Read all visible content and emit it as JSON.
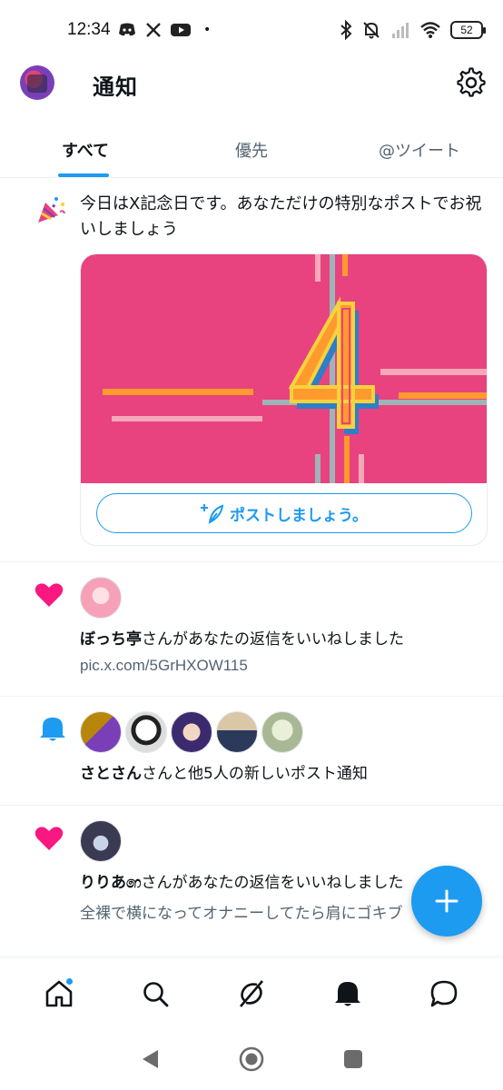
{
  "status_bar": {
    "time": "12:34",
    "battery": "52",
    "dot": "•"
  },
  "header": {
    "title": "通知"
  },
  "tabs": [
    {
      "label": "すべて"
    },
    {
      "label": "優先"
    },
    {
      "label": "@ツイート"
    }
  ],
  "items": {
    "anniversary": {
      "text": "今日はX記念日です。あなただけの特別なポストでお祝いしましょう",
      "button_label": "ポストしましょう。"
    },
    "like1": {
      "user": "ぼっち亭",
      "action": "さんがあなたの返信をいいねしました",
      "link": "pic.x.com/5GrHXOW115"
    },
    "notify": {
      "user": "さとさん",
      "action": "さんと他5人の新しいポスト通知"
    },
    "like2": {
      "user": "りりあ෨",
      "action": "さんがあなたの返信をいいねしました",
      "preview": "全裸で横になってオナニーしてたら肩にゴキブ"
    }
  },
  "colors": {
    "accent": "#1d9bf0",
    "heart": "#f91880",
    "card_bg": "#e8437f"
  },
  "icons": {
    "settings": "gear-icon",
    "home": "home-icon",
    "search": "search-icon",
    "grok": "grok-icon",
    "notifications": "bell-icon",
    "messages": "message-icon"
  }
}
